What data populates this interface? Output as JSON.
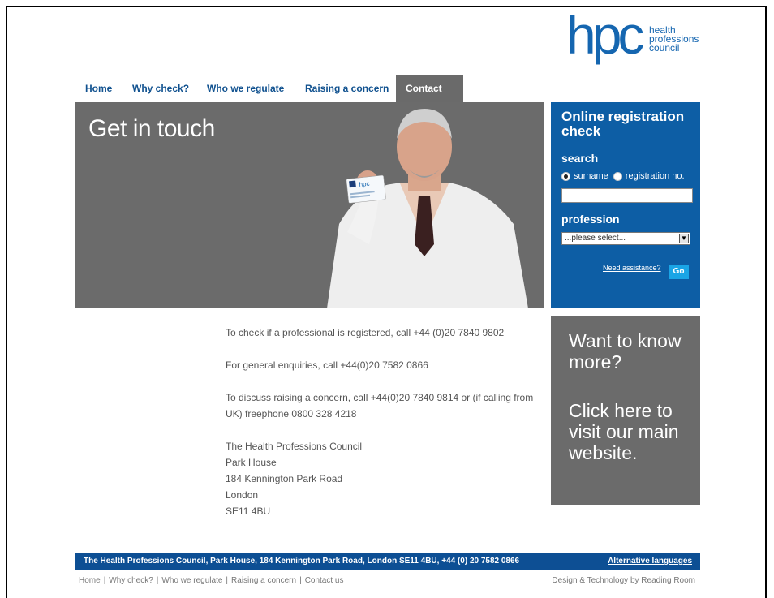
{
  "logo": {
    "mark": "hpc",
    "line1": "health",
    "line2": "professions",
    "line3": "council"
  },
  "nav": {
    "items": [
      {
        "label": "Home",
        "active": false
      },
      {
        "label": "Why check?",
        "active": false
      },
      {
        "label": "Who we regulate",
        "active": false
      },
      {
        "label": "Raising a concern",
        "active": false
      },
      {
        "label": "Contact us",
        "active": true
      }
    ]
  },
  "hero": {
    "title": "Get in touch",
    "card_text": "hpc"
  },
  "registration": {
    "title": "Online registration check",
    "search_label": "search",
    "radio_surname": "surname",
    "radio_regno": "registration no.",
    "search_value": "",
    "profession_label": "profession",
    "profession_selected": "...please select...",
    "assist_link": "Need assistance?",
    "go_button": "Go"
  },
  "contact": {
    "line1": "To check if a professional is registered, call +44 (0)20 7840 9802",
    "line2": "For general enquiries, call +44(0)20 7582 0866",
    "line3": "To discuss raising a concern, call +44(0)20 7840 9814 or (if calling from UK) freephone 0800 328 4218",
    "address": [
      "The Health Professions Council",
      "Park House",
      "184 Kennington Park Road",
      "London",
      "SE11 4BU"
    ]
  },
  "more_box": {
    "line1": "Want to know more?",
    "line2": "Click here to visit our main website."
  },
  "footer": {
    "address": "The Health Professions Council, Park House, 184 Kennington Park Road, London SE11 4BU, +44 (0) 20 7582 0866",
    "alt_languages": "Alternative languages",
    "links": [
      "Home",
      "Why check?",
      "Who we regulate",
      "Raising a concern",
      "Contact us"
    ],
    "credit": "Design & Technology by Reading Room"
  },
  "colors": {
    "brand_blue": "#0d5ea5",
    "nav_text": "#10518f",
    "panel_grey": "#6b6b6b",
    "go_button": "#1aa5e6"
  }
}
